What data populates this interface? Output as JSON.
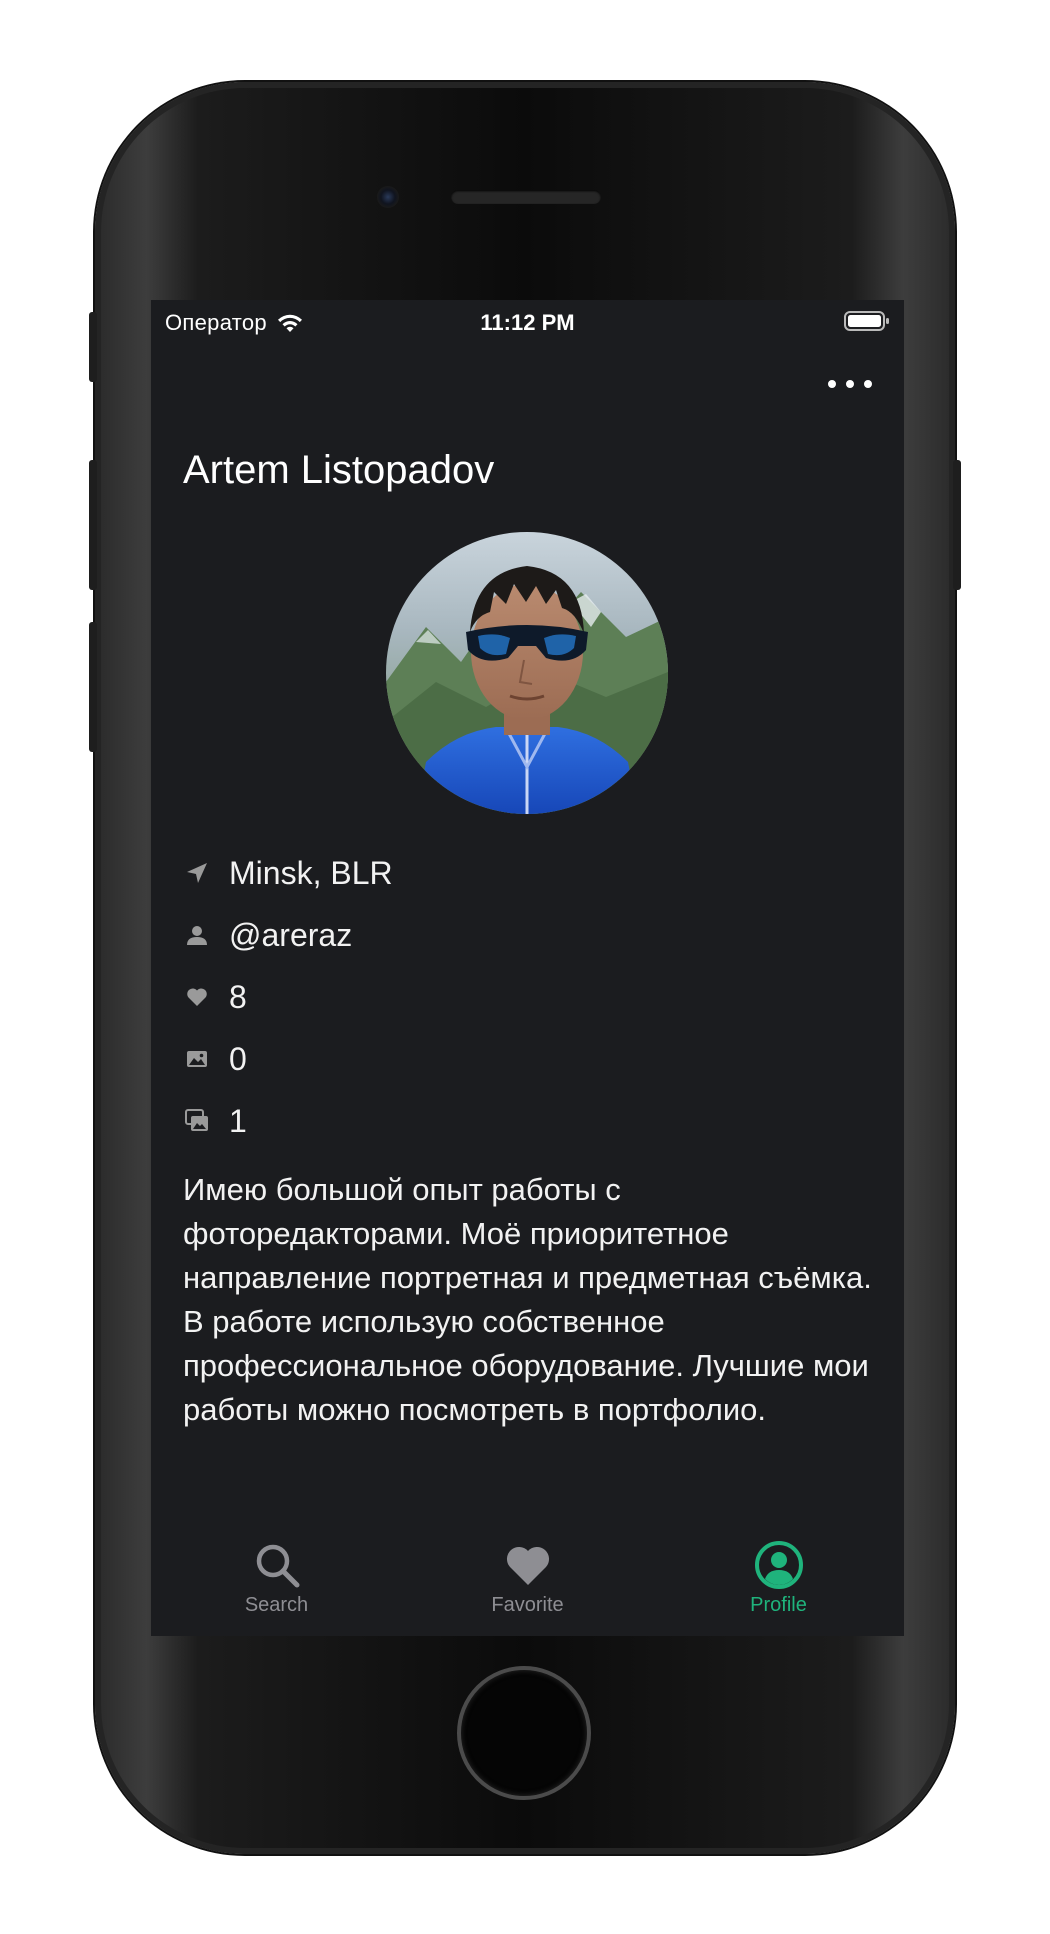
{
  "status_bar": {
    "carrier": "Оператор",
    "time": "11:12 PM"
  },
  "profile": {
    "name": "Artem Listopadov",
    "info": [
      {
        "icon": "location-arrow-icon",
        "value": "Minsk, BLR"
      },
      {
        "icon": "person-icon",
        "value": "@areraz"
      },
      {
        "icon": "heart-icon",
        "value": "8"
      },
      {
        "icon": "photo-icon",
        "value": "0"
      },
      {
        "icon": "photo-collection-icon",
        "value": "1"
      }
    ],
    "bio": "Имею большой опыт работы с фоторедакторами. Моё приоритетное направление портретная и предметная съёмка. В работе использую собственное профессиональное оборудование. Лучшие мои работы можно посмотреть в портфолио."
  },
  "tab_bar": {
    "tabs": [
      {
        "label": "Search",
        "icon": "search-icon",
        "active": false
      },
      {
        "label": "Favorite",
        "icon": "heart-icon",
        "active": false
      },
      {
        "label": "Profile",
        "icon": "profile-circle-icon",
        "active": true
      }
    ]
  },
  "colors": {
    "background": "#1b1c1f",
    "accent": "#1fb37c",
    "inactive": "#8e8e93",
    "icon": "#9a9a9a"
  }
}
